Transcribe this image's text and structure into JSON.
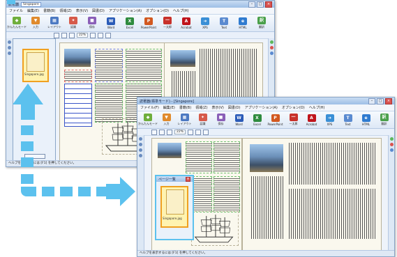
{
  "colors": {
    "arrow": "#5cc1ee",
    "selection": "#f0a020",
    "title_gradient": "#9ebfe6"
  },
  "back_window": {
    "title_prefix": "読著器",
    "tab": "Singapore",
    "menu": [
      "ファイル",
      "編集(E)",
      "書籍(B)",
      "領域(Z)",
      "表示(V)",
      "図書(D)",
      "アプリケーション(A)",
      "オプション(O)",
      "ヘルプ(H)"
    ],
    "toolbar": [
      {
        "label": "かんたんモード",
        "icon": "easy-mode-icon"
      },
      {
        "label": "入力",
        "icon": "input-icon"
      },
      {
        "label": "レイアウト",
        "icon": "layout-icon"
      },
      {
        "label": "認識",
        "icon": "recognize-icon"
      },
      {
        "label": "保存",
        "icon": "save-icon"
      },
      {
        "label": "Word",
        "icon": "word-icon"
      },
      {
        "label": "Excel",
        "icon": "excel-icon"
      },
      {
        "label": "PowerPoint",
        "icon": "powerpoint-icon"
      },
      {
        "label": "一太郎",
        "icon": "ichitaro-icon"
      },
      {
        "label": "Acrobat",
        "icon": "acrobat-icon"
      },
      {
        "label": "XPS",
        "icon": "xps-icon"
      },
      {
        "label": "Text",
        "icon": "text-icon"
      },
      {
        "label": "HTML",
        "icon": "html-icon"
      },
      {
        "label": "翻訳",
        "icon": "translate-icon"
      }
    ],
    "zoom": "22%",
    "thumb_label": "Singapore.jpg",
    "status": "ヘルプを表示するには [F1] を押してください。"
  },
  "front_window": {
    "title": "読著器(標準モード) - [Singapore]",
    "menu": [
      "ファイル(F)",
      "編集(E)",
      "書籍(B)",
      "領域(Z)",
      "表示(V)",
      "図書(D)",
      "アプリケーション(A)",
      "オプション(O)",
      "ヘルプ(H)"
    ],
    "toolbar": [
      {
        "label": "かんたんモード",
        "icon": "easy-mode-icon"
      },
      {
        "label": "入力",
        "icon": "input-icon"
      },
      {
        "label": "レイアウト",
        "icon": "layout-icon"
      },
      {
        "label": "認識",
        "icon": "recognize-icon"
      },
      {
        "label": "保存",
        "icon": "save-icon"
      },
      {
        "label": "Word",
        "icon": "word-icon"
      },
      {
        "label": "Excel",
        "icon": "excel-icon"
      },
      {
        "label": "PowerPoint",
        "icon": "powerpoint-icon"
      },
      {
        "label": "一太郎",
        "icon": "ichitaro-icon"
      },
      {
        "label": "Acrobat",
        "icon": "acrobat-icon"
      },
      {
        "label": "XPS",
        "icon": "xps-icon"
      },
      {
        "label": "Text",
        "icon": "text-icon"
      },
      {
        "label": "HTML",
        "icon": "html-icon"
      },
      {
        "label": "翻訳",
        "icon": "translate-icon"
      }
    ],
    "zoom": "22%",
    "page_panel_title": "ページ一覧",
    "thumb_label": "Singapore.jpg",
    "status": "ヘルプを表示するには [F1] を押してください。"
  }
}
